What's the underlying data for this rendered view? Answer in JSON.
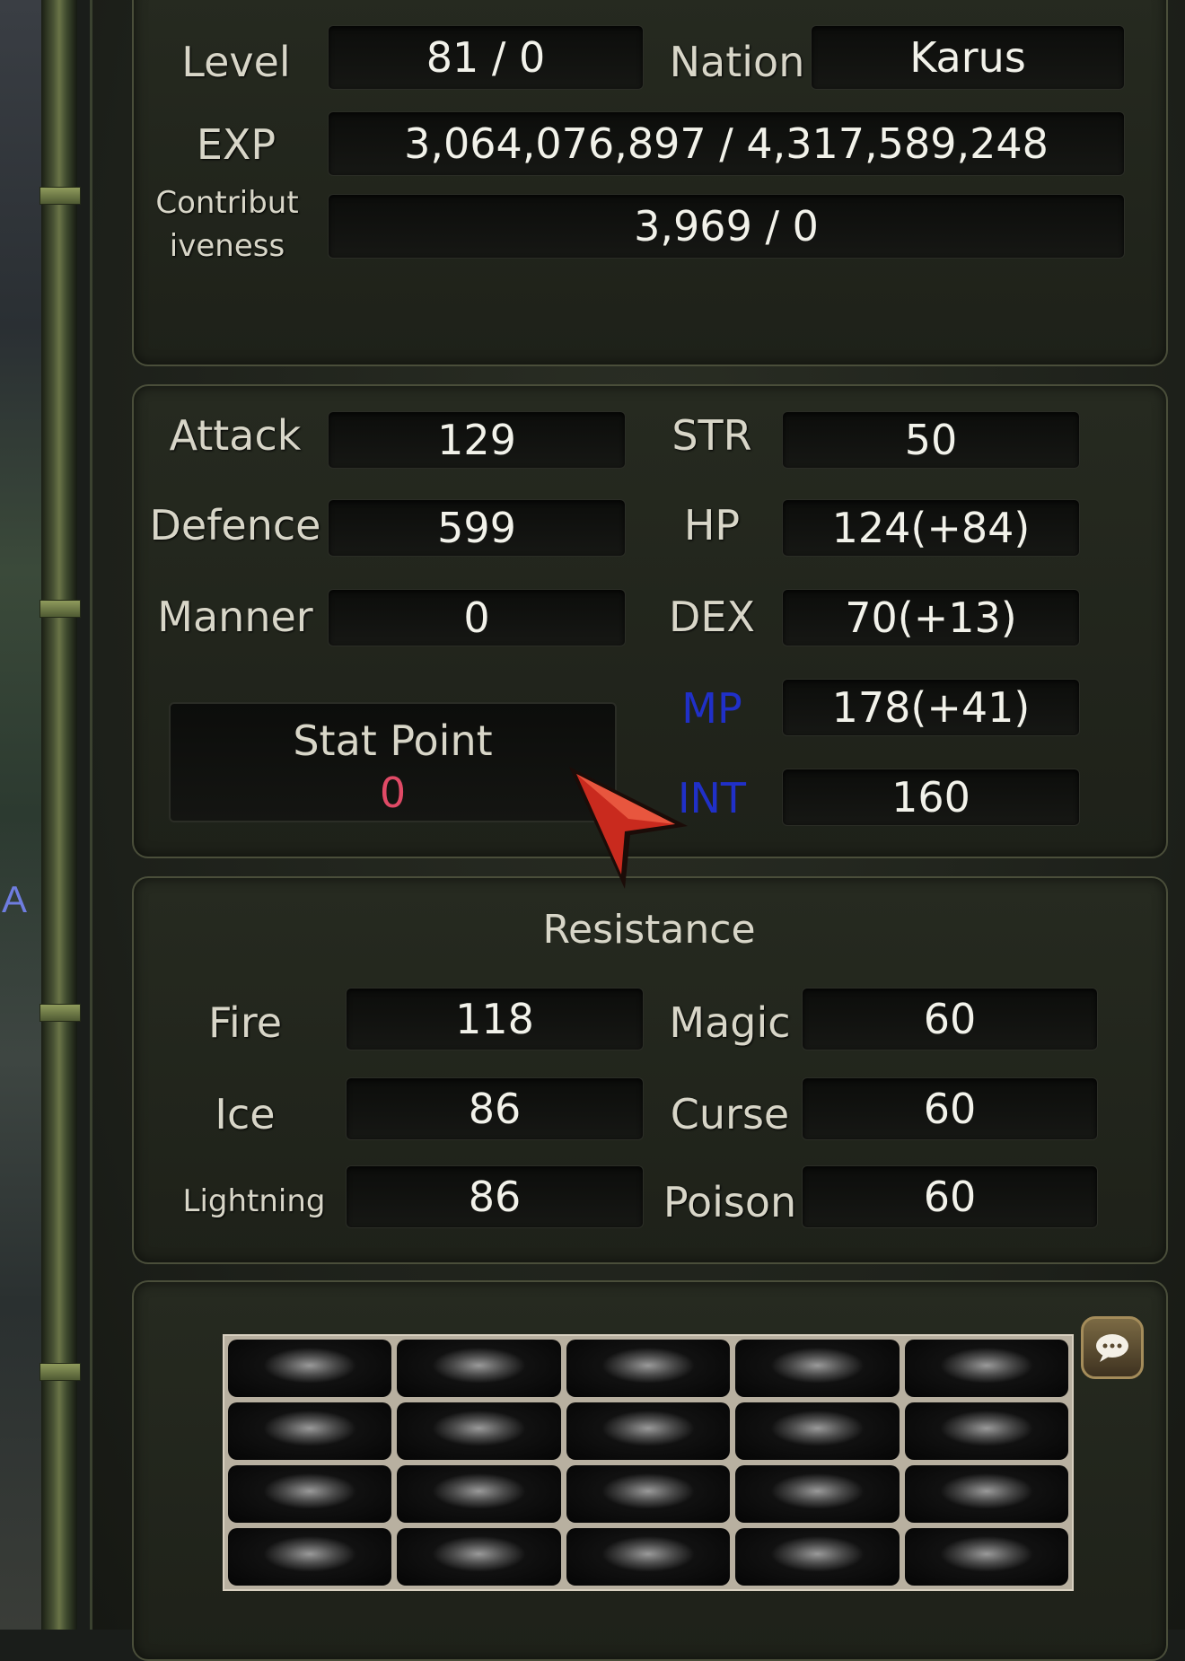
{
  "character": {
    "level_label": "Level",
    "level_value": "81 / 0",
    "nation_label": "Nation",
    "nation_value": "Karus",
    "exp_label": "EXP",
    "exp_value": "3,064,076,897 / 4,317,589,248",
    "contrib_label_1": "Contribut",
    "contrib_label_2": "iveness",
    "contrib_value": "3,969 / 0"
  },
  "stats": {
    "attack_label": "Attack",
    "attack_value": "129",
    "defence_label": "Defence",
    "defence_value": "599",
    "manner_label": "Manner",
    "manner_value": "0",
    "str_label": "STR",
    "str_value": "50",
    "hp_label": "HP",
    "hp_value": "124(+84)",
    "dex_label": "DEX",
    "dex_value": "70(+13)",
    "mp_label": "MP",
    "mp_value": "178(+41)",
    "int_label": "INT",
    "int_value": "160",
    "stat_point_label": "Stat Point",
    "stat_point_value": "0"
  },
  "resistance": {
    "title": "Resistance",
    "fire_label": "Fire",
    "fire_value": "118",
    "ice_label": "Ice",
    "ice_value": "86",
    "lightning_label": "Lightning",
    "lightning_value": "86",
    "magic_label": "Magic",
    "magic_value": "60",
    "curse_label": "Curse",
    "curse_value": "60",
    "poison_label": "Poison",
    "poison_value": "60"
  },
  "world": {
    "edge_text": "A"
  },
  "colors": {
    "accent_blue": "#2030c8",
    "stat_point_red": "#e04a66"
  },
  "icons": {
    "chat": "chat-bubble-icon",
    "cursor": "red-arrow-cursor-icon"
  }
}
